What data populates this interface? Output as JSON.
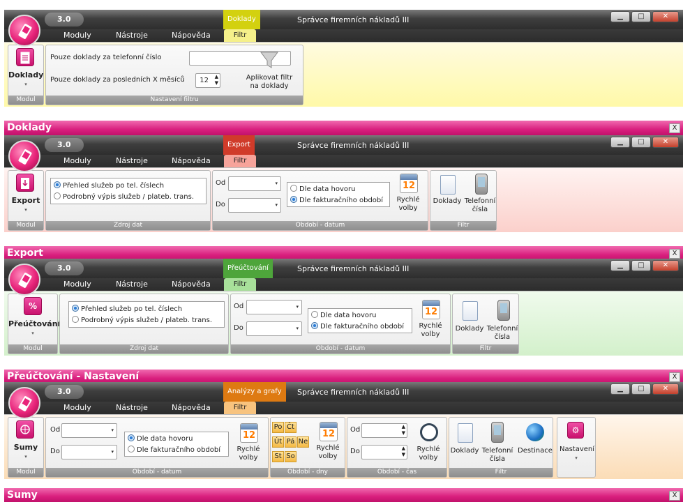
{
  "common": {
    "version": "3.0",
    "title": "Správce firemních nákladů III",
    "menu": [
      "Moduly",
      "Nástroje",
      "Nápověda"
    ],
    "filter_tab": "Filtr",
    "window_buttons": {
      "minimize": "▁",
      "maximize": "□",
      "close": "✕"
    },
    "close_x": "X",
    "dropdown_arrow": "▾"
  },
  "windows": [
    {
      "context": "Doklady",
      "context_color": "#d3d10f",
      "ribbon_color": "#fffdc8",
      "tab_color": "#f5f08a",
      "module": "Doklady",
      "module_caption": "Modul",
      "phone_label": "Pouze doklady za telefonní číslo",
      "months_label": "Pouze doklady za posledních X měsíců",
      "months_value": "12",
      "apply_label": "Aplikovat filtr na doklady",
      "group_caption": "Nastavení filtru",
      "status": "Doklady"
    },
    {
      "context": "Export",
      "context_color": "#d03b2a",
      "ribbon_color": "#fde0dd",
      "tab_color": "#f7a39a",
      "module": "Export",
      "module_caption": "Modul",
      "source_options": [
        "Přehled služeb po tel. číslech",
        "Podrobný výpis služeb / plateb. trans."
      ],
      "source_caption": "Zdroj dat",
      "od": "Od",
      "do": "Do",
      "period_options": [
        "Dle data hovoru",
        "Dle fakturačního období"
      ],
      "quick": "Rychlé volby",
      "period_caption": "Období - datum",
      "filter_buttons": [
        "Doklady",
        "Telefonní čísla"
      ],
      "filter_caption": "Filtr",
      "status": "Export"
    },
    {
      "context": "Přeúčtování",
      "context_color": "#4ea53b",
      "ribbon_color": "#e2f5de",
      "tab_color": "#a8e09a",
      "module": "Přeúčtování",
      "module_caption": "Modul",
      "module_icon": "%",
      "source_options": [
        "Přehled služeb po tel. číslech",
        "Podrobný výpis služeb / plateb. trans."
      ],
      "source_caption": "Zdroj dat",
      "od": "Od",
      "do": "Do",
      "period_options": [
        "Dle data hovoru",
        "Dle fakturačního období"
      ],
      "quick": "Rychlé volby",
      "period_caption": "Období - datum",
      "filter_buttons": [
        "Doklady",
        "Telefonní čísla"
      ],
      "filter_caption": "Filtr",
      "status": "Přeúčtování - Nastavení"
    },
    {
      "context": "Analýzy a grafy",
      "context_color": "#de7a12",
      "ribbon_color": "#fde8cf",
      "tab_color": "#f8c37e",
      "module": "Sumy",
      "module_caption": "Modul",
      "od": "Od",
      "do": "Do",
      "period_options": [
        "Dle data hovoru",
        "Dle fakturačního období"
      ],
      "quick": "Rychlé volby",
      "period_caption": "Období - datum",
      "days": [
        "Po",
        "Čt",
        "Út",
        "Pá",
        "Ne",
        "St",
        "So"
      ],
      "days_caption": "Období - dny",
      "time_caption": "Období - čas",
      "filter_buttons": [
        "Doklady",
        "Telefonní čísla",
        "Destinace"
      ],
      "filter_caption": "Filtr",
      "settings": "Nastavení",
      "status": "Sumy"
    }
  ]
}
